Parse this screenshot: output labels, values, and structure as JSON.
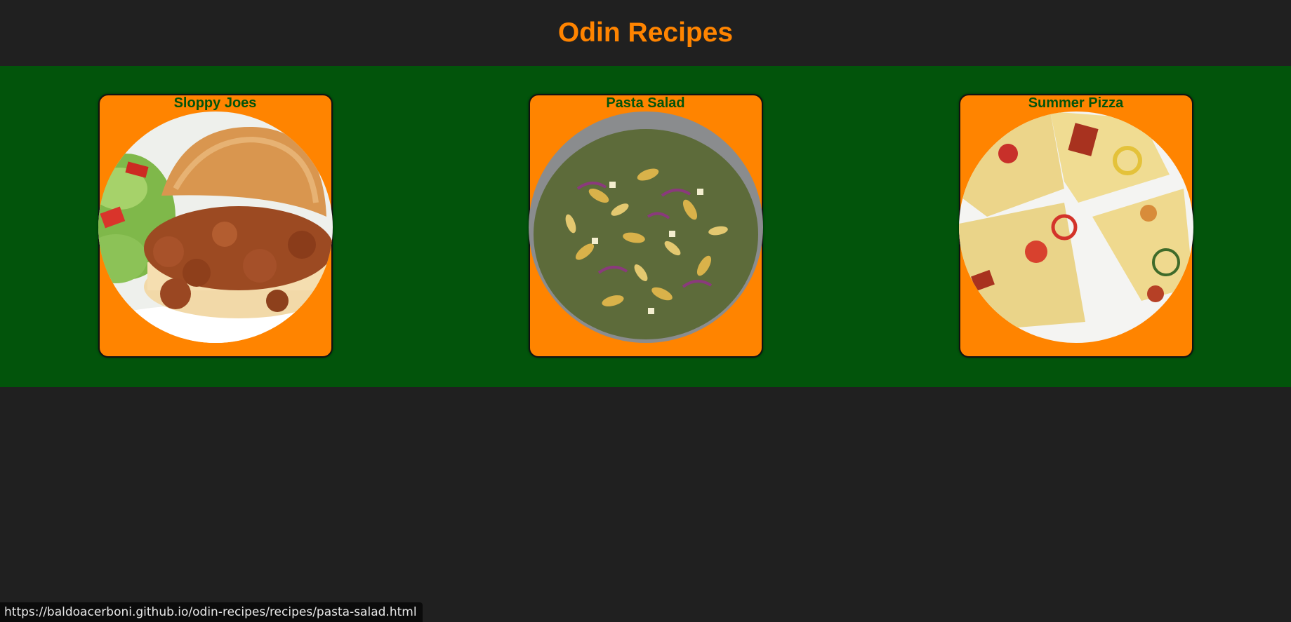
{
  "header": {
    "title": "Odin Recipes",
    "title_color": "#ff8400",
    "background": "#202020"
  },
  "band": {
    "background": "#02540b"
  },
  "recipes": [
    {
      "title": "Sloppy Joes",
      "image": "sloppy-joes-photo"
    },
    {
      "title": "Pasta Salad",
      "image": "pasta-salad-photo"
    },
    {
      "title": "Summer Pizza",
      "image": "summer-pizza-photo"
    }
  ],
  "status_bar": {
    "url": "https://baldoacerboni.github.io/odin-recipes/recipes/pasta-salad.html"
  }
}
